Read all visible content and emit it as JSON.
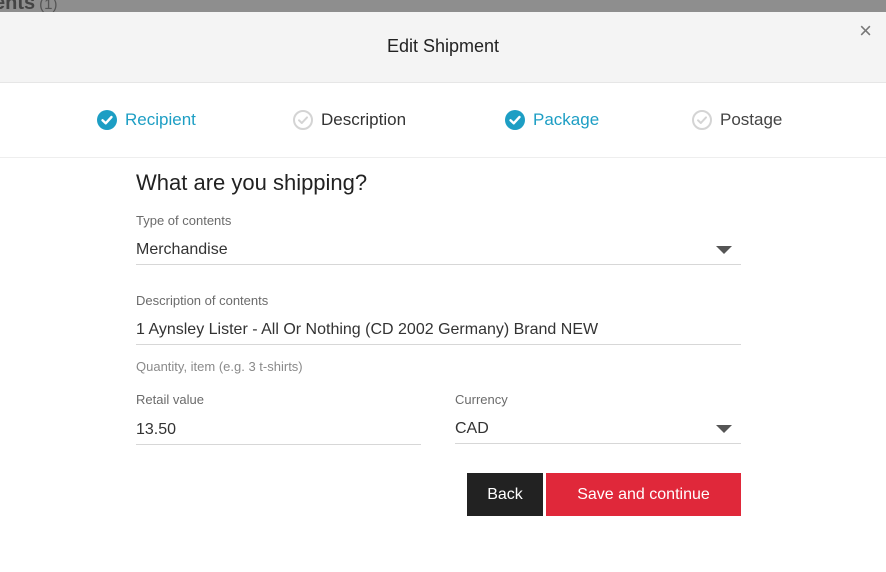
{
  "backdrop": {
    "text": "ents",
    "count": "(1)"
  },
  "modal": {
    "title": "Edit Shipment",
    "close_glyph": "×"
  },
  "steps": [
    {
      "label": "Recipient",
      "state": "complete"
    },
    {
      "label": "Description",
      "state": "current"
    },
    {
      "label": "Package",
      "state": "complete"
    },
    {
      "label": "Postage",
      "state": "pending"
    }
  ],
  "form": {
    "title": "What are you shipping?",
    "type_label": "Type of contents",
    "type_value": "Merchandise",
    "desc_label": "Description of contents",
    "desc_value": "1 Aynsley Lister - All Or Nothing (CD 2002 Germany) Brand NEW",
    "desc_helper": "Quantity, item (e.g. 3 t-shirts)",
    "retail_label": "Retail value",
    "retail_value": "13.50",
    "currency_label": "Currency",
    "currency_value": "CAD"
  },
  "buttons": {
    "back": "Back",
    "save": "Save and continue"
  },
  "colors": {
    "accent": "#1d9ec4",
    "primary_button": "#e0283a",
    "secondary_button": "#222222"
  }
}
